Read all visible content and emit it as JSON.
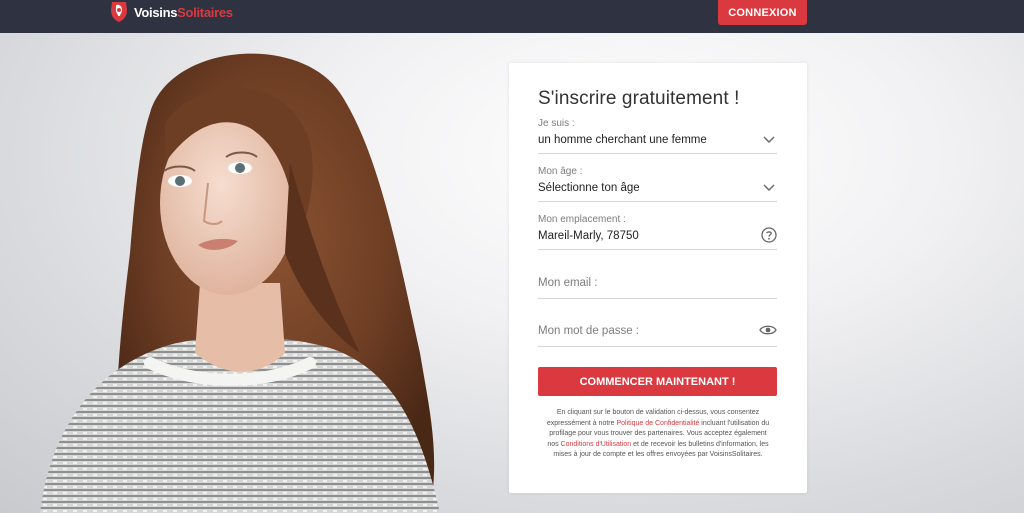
{
  "header": {
    "logo_part1": "Voisins",
    "logo_part2": "Solitaires",
    "login_label": "CONNEXION"
  },
  "form": {
    "title": "S'inscrire gratuitement !",
    "seeking": {
      "label": "Je suis :",
      "value": "un homme cherchant une femme"
    },
    "age": {
      "label": "Mon âge :",
      "value": "Sélectionne ton âge"
    },
    "location": {
      "label": "Mon emplacement :",
      "value": "Mareil-Marly, 78750"
    },
    "email": {
      "placeholder": "Mon email :"
    },
    "password": {
      "placeholder": "Mon mot de passe :"
    },
    "submit_label": "COMMENCER MAINTENANT !",
    "legal": {
      "part1": "En cliquant sur le bouton de validation ci-dessus, vous consentez expressément à notre ",
      "privacy_link": "Politique de Confidentialité",
      "part2": " incluant l'utilisation du profilage pour vous trouver des partenaires. Vous acceptez également nos ",
      "terms_link": "Conditions d'Utilisation",
      "part3": " et de recevoir les bulletins d'information, les mises à jour de compte et les offres envoyées par VoisinsSolitaires."
    }
  },
  "colors": {
    "accent": "#d9393f",
    "topbar": "#2f3240"
  },
  "icons": {
    "select": "chevron-down-icon",
    "location_help": "question-circle-icon",
    "password": "eye-icon"
  }
}
